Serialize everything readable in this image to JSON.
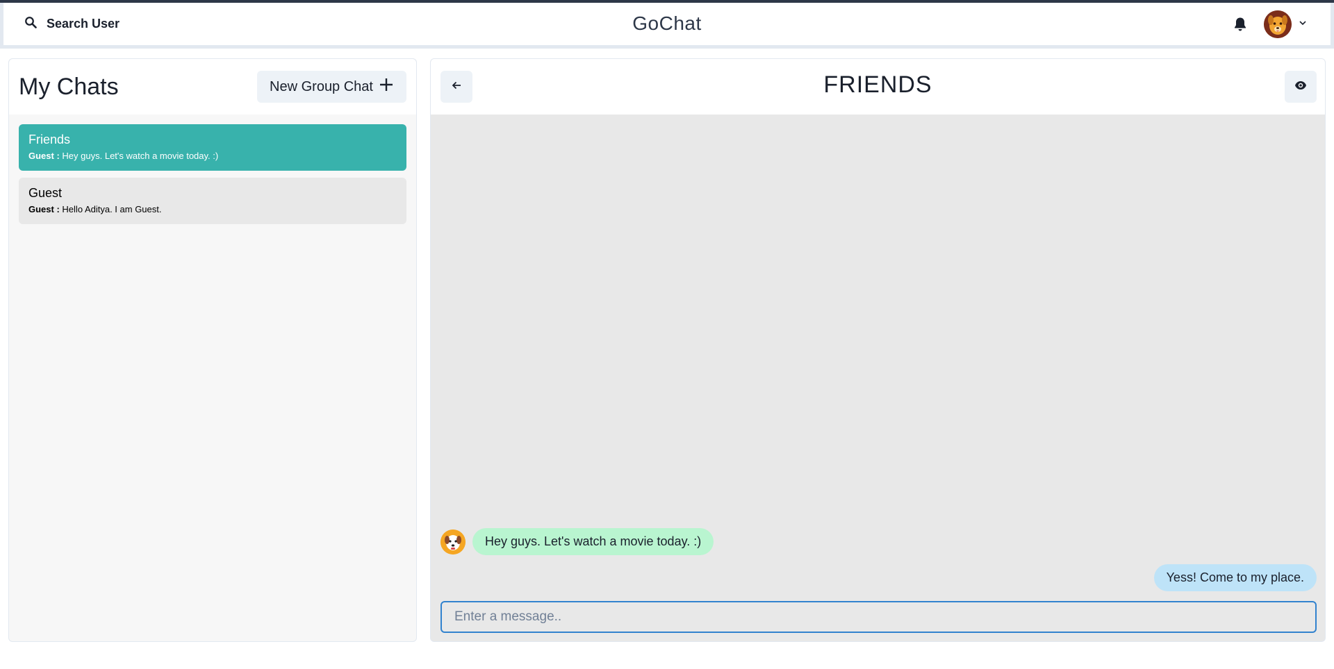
{
  "header": {
    "search_label": "Search User",
    "app_title": "GoChat"
  },
  "sidebar": {
    "title": "My Chats",
    "new_group_label": "New Group Chat",
    "chats": [
      {
        "name": "Friends",
        "sender": "Guest :",
        "preview": "Hey guys. Let's watch a movie today. :)",
        "active": true
      },
      {
        "name": "Guest",
        "sender": "Guest :",
        "preview": "Hello Aditya. I am Guest.",
        "active": false
      }
    ]
  },
  "conversation": {
    "title": "FRIENDS",
    "messages": [
      {
        "text": "Hey guys. Let's watch a movie today. :)",
        "direction": "received"
      },
      {
        "text": "Yess! Come to my place.",
        "direction": "sent"
      }
    ],
    "input_placeholder": "Enter a message.."
  },
  "colors": {
    "active_chat": "#38b2ac",
    "received_bubble": "#b9f5d0",
    "sent_bubble": "#bee3f8",
    "input_focus_border": "#3182ce"
  },
  "icons": {
    "search": "search-icon",
    "notifications": "bell-icon",
    "profile_menu": "chevron-down-icon",
    "new_group": "plus-icon",
    "back": "arrow-left-icon",
    "view": "eye-icon"
  }
}
